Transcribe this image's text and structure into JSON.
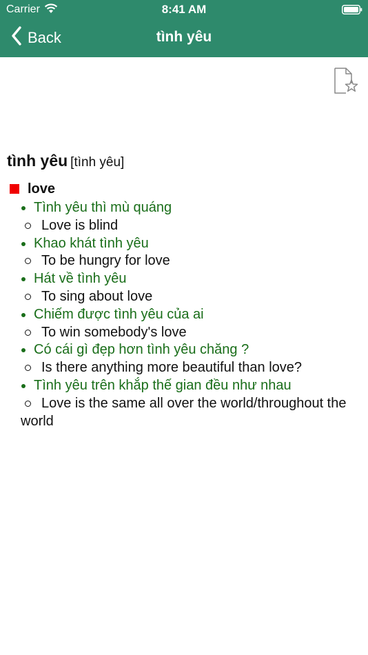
{
  "status": {
    "carrier": "Carrier",
    "time": "8:41 AM"
  },
  "nav": {
    "back_label": "Back",
    "title": "tình yêu"
  },
  "entry": {
    "headword": "tình yêu",
    "pronunciation": "[tình yêu]",
    "meaning": "love",
    "examples": [
      {
        "vi": "Tình yêu thì mù quáng",
        "en": "Love is blind"
      },
      {
        "vi": "Khao khát tình yêu",
        "en": "To be hungry for love"
      },
      {
        "vi": "Hát về tình yêu",
        "en": "To sing about love"
      },
      {
        "vi": "Chiếm được tình yêu của ai",
        "en": "To win somebody's love"
      },
      {
        "vi": "Có cái gì đẹp hơn tình yêu chăng ?",
        "en": "Is there anything more beautiful than love?"
      },
      {
        "vi": "Tình yêu trên khắp thế gian đều như nhau",
        "en": "Love is the same all over the world/throughout the world"
      }
    ]
  },
  "colors": {
    "header": "#2e8a6c",
    "example_text": "#1a6e1a",
    "meaning_marker": "#f00000"
  },
  "icons": {
    "back": "chevron-left-icon",
    "bookmark": "document-star-icon",
    "wifi": "wifi-icon",
    "battery": "battery-icon"
  }
}
